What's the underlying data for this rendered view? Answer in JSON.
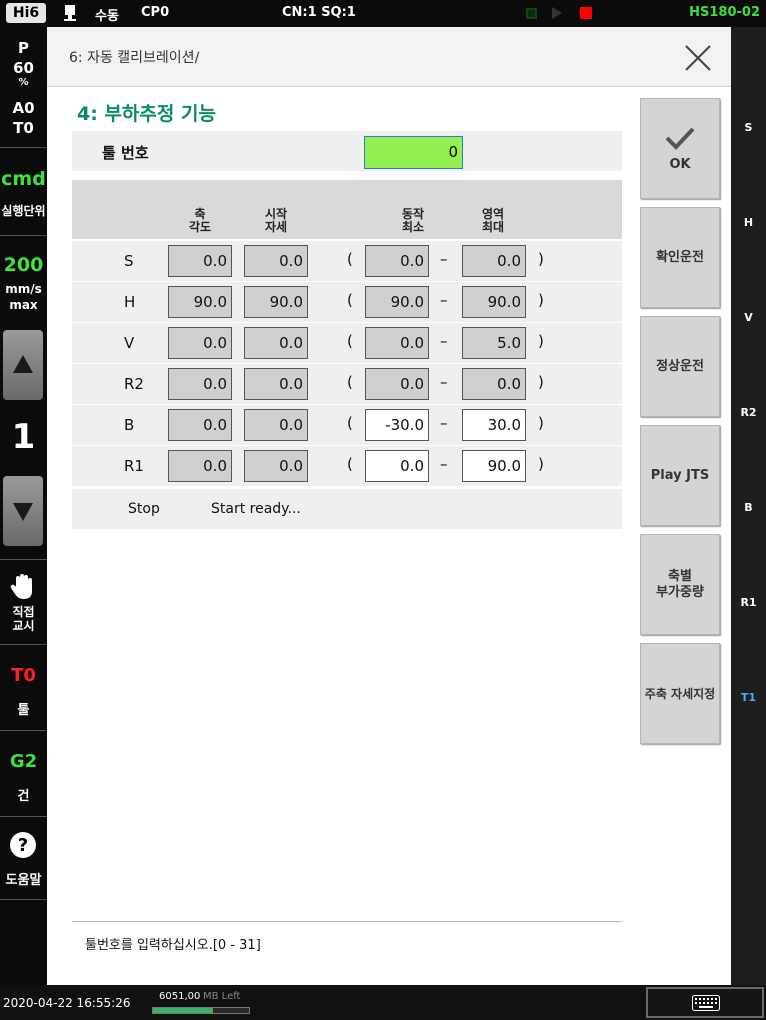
{
  "top_bar": {
    "brand": "Hi6",
    "mode": "수동",
    "program": "CP0",
    "cn_sq": "CN:1 SQ:1",
    "model": "HS180-02",
    "colors": {
      "model": "#3ee03e",
      "stop_led": "#ff0000"
    }
  },
  "left_bar": {
    "speed_mode": "P",
    "override_value": "60",
    "override_unit": "%",
    "a_label": "A0",
    "t_label": "T0",
    "cmd_label": "cmd",
    "exec_unit_label": "실행단위",
    "speed_value": "200",
    "speed_unit": "mm/s",
    "speed_max": "max",
    "step_value": "1",
    "direct_teach_label": "직접\n교시",
    "tool_badge": "T0",
    "tool_label": "툴",
    "gun_badge": "G2",
    "gun_label": "건",
    "help_label": "도움말",
    "icons": [
      "up-arrow-icon",
      "down-arrow-icon",
      "hand-icon",
      "help-icon"
    ]
  },
  "right_bar": {
    "axes": [
      "S",
      "H",
      "V",
      "R2",
      "B",
      "R1",
      "T1"
    ],
    "highlight_color": "#4aa8ff"
  },
  "bottom_bar": {
    "datetime": "2020-04-22 16:55:26",
    "memory": "6051,00",
    "memory_unit": "MB Left",
    "memory_fraction": 0.62
  },
  "dialog": {
    "breadcrumb": "6: 자동 캘리브레이션/",
    "section_title": "4: 부하추정 기능",
    "tool_number_label": "툴 번호",
    "tool_number_value": "0",
    "headers": {
      "axis_angle": "축\n각도",
      "start_pose": "시작\n자세",
      "motion_min": "동작\n최소",
      "range_max": "영역\n최대"
    },
    "rows": [
      {
        "axis": "S",
        "angle": "0.0",
        "start": "0.0",
        "min": "0.0",
        "max": "0.0"
      },
      {
        "axis": "H",
        "angle": "90.0",
        "start": "90.0",
        "min": "90.0",
        "max": "90.0"
      },
      {
        "axis": "V",
        "angle": "0.0",
        "start": "0.0",
        "min": "0.0",
        "max": "5.0"
      },
      {
        "axis": "R2",
        "angle": "0.0",
        "start": "0.0",
        "min": "0.0",
        "max": "0.0"
      },
      {
        "axis": "B",
        "angle": "0.0",
        "start": "0.0",
        "min": "-30.0",
        "max": "30.0"
      },
      {
        "axis": "R1",
        "angle": "0.0",
        "start": "0.0",
        "min": "0.0",
        "max": "90.0"
      }
    ],
    "paren_open": "(",
    "paren_close": ")",
    "dash": "–",
    "status_left": "Stop",
    "status_right": "Start ready...",
    "message": "툴번호를 입력하십시오.[0 - 31]"
  },
  "side_buttons": {
    "ok": "OK",
    "confirm_run": "확인운전",
    "normal_run": "정상운전",
    "play_jts": "Play JTS",
    "axis_payload": "축별\n부가중량",
    "main_axis_pose": "주축 자세지정"
  },
  "colors": {
    "accent_title": "#0b8a6b",
    "tool_input_bg": "#93f050",
    "cmd_green": "#3ee03e",
    "t0_red": "#ff2020"
  }
}
